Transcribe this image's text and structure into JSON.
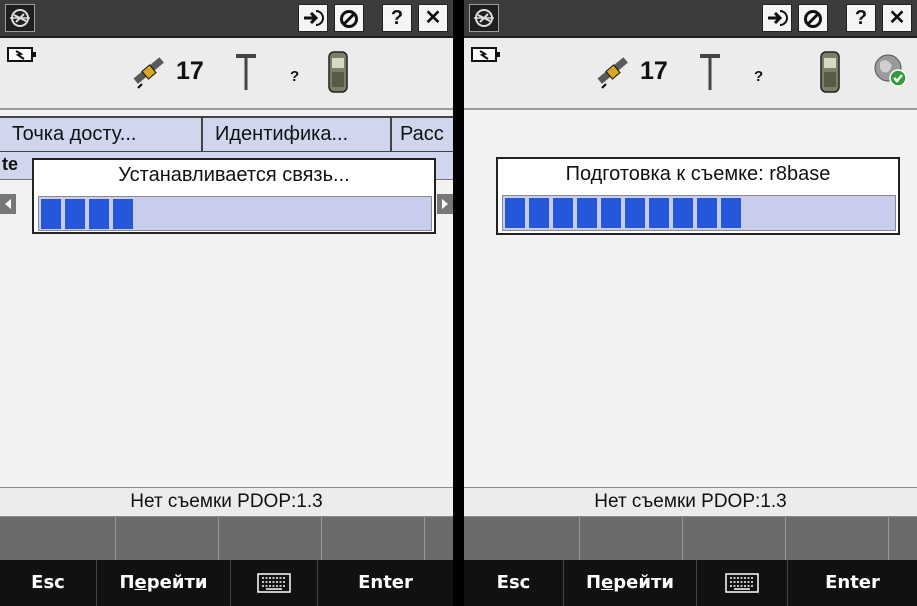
{
  "left": {
    "satellite_count": "17",
    "unknown_marker": "?",
    "table_headers": [
      "Точка досту...",
      "Идентифика...",
      "Расс"
    ],
    "row_text": "te",
    "dialog_title": "Устанавливается связь...",
    "progress": 0.25,
    "progress_segments": 4,
    "status_text": "Нет съемки  PDOP:1.3"
  },
  "right": {
    "satellite_count": "17",
    "unknown_marker": "?",
    "dialog_title": "Подготовка к съемке: r8base",
    "progress": 0.6,
    "progress_segments": 10,
    "status_text": "Нет съемки  PDOP:1.3"
  },
  "titlebar": {
    "help_label": "?",
    "close_label": "✕"
  },
  "keys": {
    "esc": "Esc",
    "goto_pre": "П",
    "goto_u": "е",
    "goto_post": "рейти",
    "enter": "Enter"
  },
  "colors": {
    "progress_fill": "#2457d9",
    "progress_track": "#c8cced",
    "titlebar": "#3c3c3c"
  }
}
